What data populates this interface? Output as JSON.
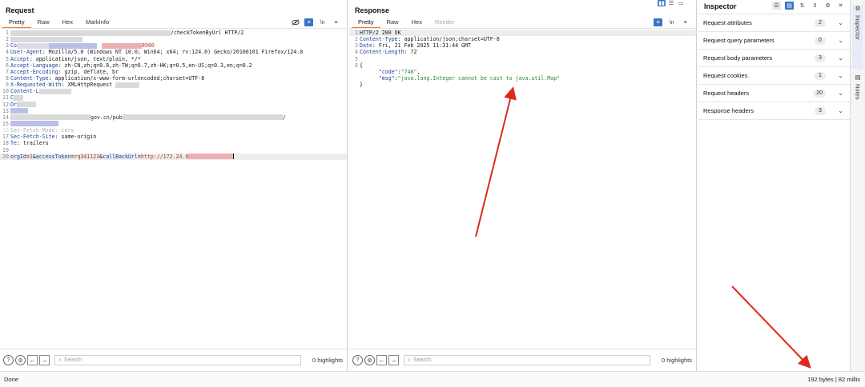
{
  "request": {
    "title": "Request",
    "tabs": [
      "Pretty",
      "Raw",
      "Hex",
      "MarkInfo"
    ],
    "line1_tail": "/checkTokenByUrl HTTP/2",
    "line3_prefix": "Co",
    "line3_tail": "8980",
    "headers": [
      {
        "name": "User-Agent",
        "value": "Mozilla/5.0 (Windows NT 10.0; Win64; x64; rv:124.0) Gecko/20100101 Firefox/124.0"
      },
      {
        "name": "Accept",
        "value": "application/json, text/plain, */*"
      },
      {
        "name": "Accept-Language",
        "value": "zh-CN,zh;q=0.8,zh-TW;q=0.7,zh-HK;q=0.5,en-US;q=0.3,en;q=0.2"
      },
      {
        "name": "Accept-Encoding",
        "value": "gzip, deflate, br"
      },
      {
        "name": "Content-Type",
        "value": "application/x-www-form-urlencoded;charset=UTF-8"
      },
      {
        "name": "X-Requested-With",
        "value": "XMLHttpRequest"
      }
    ],
    "line10": "Content-L",
    "line11": "C",
    "line12": "Or",
    "line13_mid": "gov.cn/pub",
    "line16": "Sec-Fetch-Mode: cors",
    "line17": {
      "name": "Sec-Fetch-Site",
      "value": "same-origin"
    },
    "line18": {
      "name": "Te",
      "value": "trailers"
    },
    "body": {
      "k1": "orgId",
      "v1": "1",
      "k2": "accessToken",
      "v2": "rq341123",
      "k3": "callBackUrl",
      "v3": "http://172.24.6"
    },
    "search_placeholder": "Search",
    "highlights": "0 highlights"
  },
  "response": {
    "title": "Response",
    "tabs": [
      "Pretty",
      "Raw",
      "Hex",
      "Render"
    ],
    "lines": {
      "l1": "HTTP/2 200 OK",
      "l2n": "Content-Type",
      "l2v": "application/json;charset=UTF-8",
      "l3n": "Date",
      "l3v": "Fri, 21 Feb 2025 11:31:44 GMT",
      "l4n": "Content-Length",
      "l4v": "72",
      "l6": "{",
      "l7k": "\"code\"",
      "l7v": "\"740\"",
      "l8k": "\"msg\"",
      "l8v": "\"java.lang.Integer cannot be cast to java.util.Map\"",
      "l9": "}"
    },
    "search_placeholder": "Search",
    "highlights": "0 highlights"
  },
  "inspector": {
    "title": "Inspector",
    "rows": [
      {
        "label": "Request attributes",
        "count": "2"
      },
      {
        "label": "Request query parameters",
        "count": "0"
      },
      {
        "label": "Request body parameters",
        "count": "3"
      },
      {
        "label": "Request cookies",
        "count": "1"
      },
      {
        "label": "Request headers",
        "count": "20"
      },
      {
        "label": "Response headers",
        "count": "3"
      }
    ]
  },
  "rail": {
    "inspector": "Inspector",
    "notes": "Notes"
  },
  "status": {
    "left": "Done",
    "right": "192 bytes | 82 millis"
  },
  "colors": {
    "accent": "#e8742c",
    "arrow": "#e0281e",
    "tool_blue": "#3b74c4"
  }
}
